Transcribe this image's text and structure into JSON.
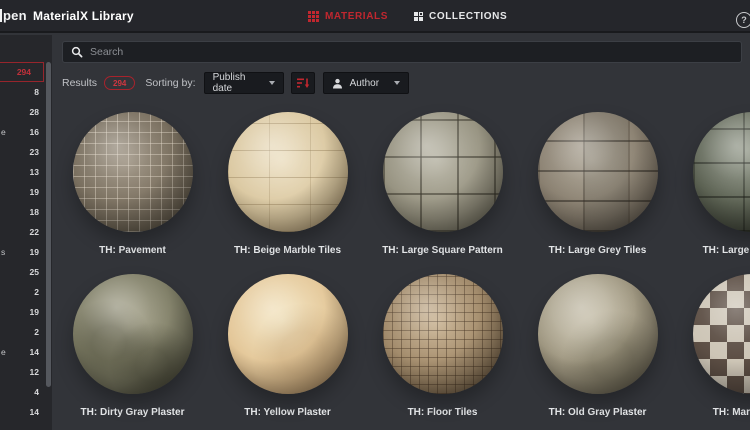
{
  "header": {
    "logo_fragment": "pen",
    "app_title": "MaterialX Library",
    "tabs": [
      {
        "label": "MATERIALS",
        "active": true
      },
      {
        "label": "COLLECTIONS",
        "active": false
      }
    ],
    "help_icon_glyph": "?"
  },
  "search": {
    "placeholder": "Search"
  },
  "toolbar": {
    "results_label": "Results",
    "results_count": "294",
    "sorting_label": "Sorting by:",
    "sort_field_value": "Publish date",
    "author_filter_value": "Author"
  },
  "sidebar": {
    "selected": {
      "count": "294"
    },
    "rows": [
      {
        "count": "8"
      },
      {
        "count": "28"
      },
      {
        "count": "16",
        "fragment": "e"
      },
      {
        "count": "23"
      },
      {
        "count": "13"
      },
      {
        "count": "19"
      },
      {
        "count": "18"
      },
      {
        "count": "22"
      },
      {
        "count": "19",
        "fragment": "s"
      },
      {
        "count": "25"
      },
      {
        "count": "2"
      },
      {
        "count": "19"
      },
      {
        "count": "2"
      },
      {
        "count": "14",
        "fragment": "e"
      },
      {
        "count": "12"
      },
      {
        "count": "4"
      },
      {
        "count": "14"
      }
    ]
  },
  "materials": [
    {
      "name": "TH: Pavement",
      "texture": "pavement"
    },
    {
      "name": "TH: Beige Marble Tiles",
      "texture": "beige-marble"
    },
    {
      "name": "TH: Large Square Pattern",
      "texture": "large-square"
    },
    {
      "name": "TH: Large Grey Tiles",
      "texture": "large-grey"
    },
    {
      "name": "TH: Large Floor Tiles",
      "texture": "large-floor"
    },
    {
      "name": "TH: Dirty Gray Plaster",
      "texture": "dirty-plaster"
    },
    {
      "name": "TH: Yellow Plaster",
      "texture": "yellow-plaster"
    },
    {
      "name": "TH: Floor Tiles",
      "texture": "floor-tiles"
    },
    {
      "name": "TH: Old Gray Plaster",
      "texture": "old-plaster"
    },
    {
      "name": "TH: Marble Floor",
      "texture": "marble-floor"
    }
  ],
  "colors": {
    "accent_red": "#c1272f",
    "header_bg": "#25262b",
    "content_bg": "#323439",
    "sidebar_bg": "#26272b"
  }
}
